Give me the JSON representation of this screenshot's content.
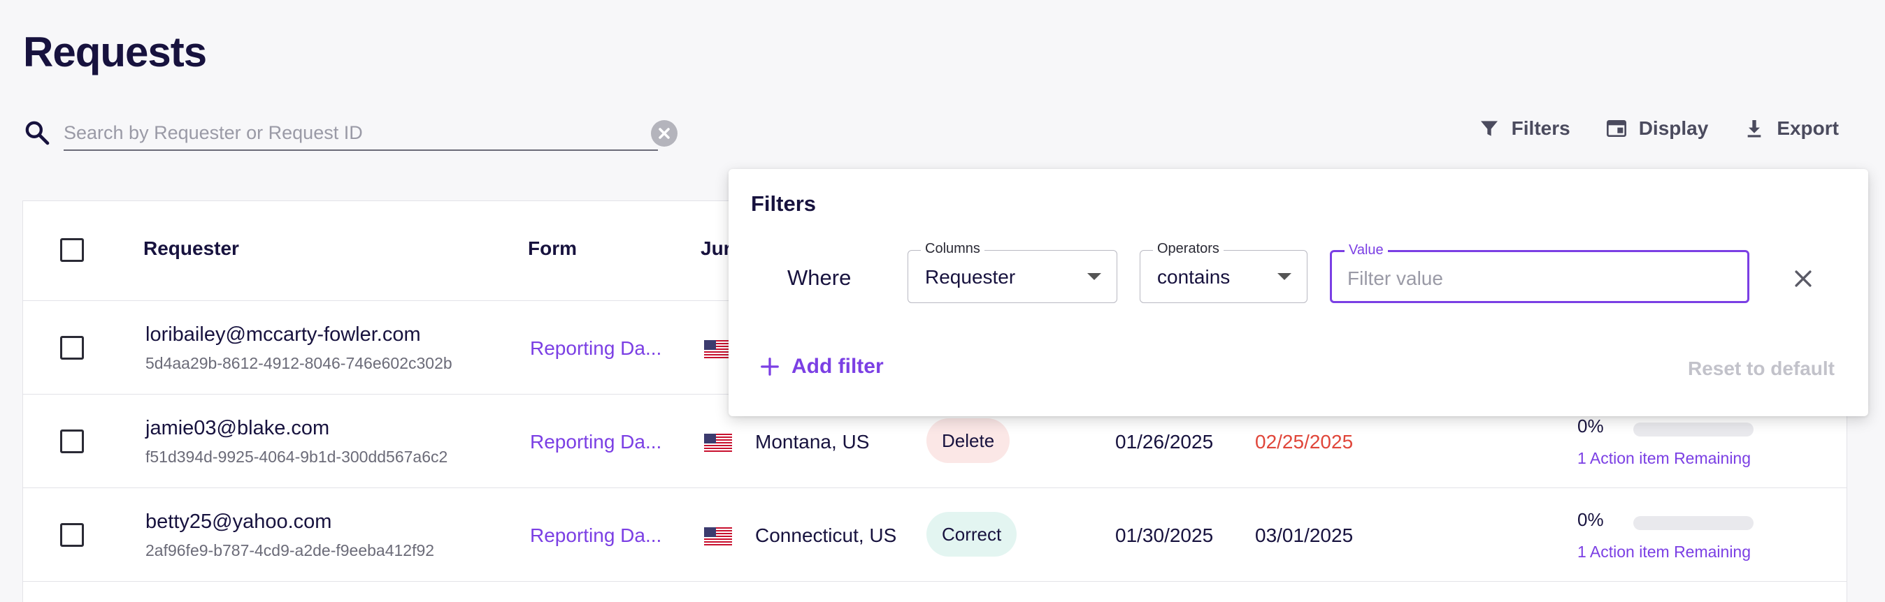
{
  "page": {
    "title": "Requests"
  },
  "search": {
    "placeholder": "Search by Requester or Request ID",
    "value": ""
  },
  "toolbar": {
    "filters_label": "Filters",
    "display_label": "Display",
    "export_label": "Export"
  },
  "table": {
    "columns": [
      "Requester",
      "Form",
      "Jur"
    ],
    "rows": [
      {
        "email": "loribailey@mccarty-fowler.com",
        "request_id": "5d4aa29b-8612-4912-8046-746e602c302b",
        "form": "Reporting Da...",
        "jurisdiction": "",
        "type": "",
        "date_received": "",
        "due_date": "",
        "progress_text": "",
        "progress": null,
        "action_text": ""
      },
      {
        "email": "jamie03@blake.com",
        "request_id": "f51d394d-9925-4064-9b1d-300dd567a6c2",
        "form": "Reporting Da...",
        "jurisdiction": "Montana, US",
        "type": "Delete",
        "date_received": "01/26/2025",
        "due_date": "02/25/2025",
        "progress_text": "0%",
        "progress": 0,
        "action_text": "1 Action item Remaining"
      },
      {
        "email": "betty25@yahoo.com",
        "request_id": "2af96fe9-b787-4cd9-a2de-f9eeba412f92",
        "form": "Reporting Da...",
        "jurisdiction": "Connecticut, US",
        "type": "Correct",
        "date_received": "01/30/2025",
        "due_date": "03/01/2025",
        "progress_text": "0%",
        "progress": 0,
        "action_text": "1 Action item Remaining"
      }
    ]
  },
  "filters_panel": {
    "title": "Filters",
    "where_label": "Where",
    "columns_label": "Columns",
    "columns_value": "Requester",
    "operators_label": "Operators",
    "operators_value": "contains",
    "value_label": "Value",
    "value_placeholder": "Filter value",
    "add_filter_label": "Add filter",
    "reset_label": "Reset to default"
  },
  "colors": {
    "accent": "#7b3fe4",
    "overdue": "#e0463a",
    "title": "#17123e",
    "badge_delete": "#fbe7e6",
    "badge_correct": "#e3f5f1"
  },
  "icons": [
    "search-icon",
    "clear-icon",
    "filter-icon",
    "display-icon",
    "export-icon",
    "us-flag-icon",
    "close-icon",
    "plus-icon",
    "chevron-down-icon"
  ]
}
